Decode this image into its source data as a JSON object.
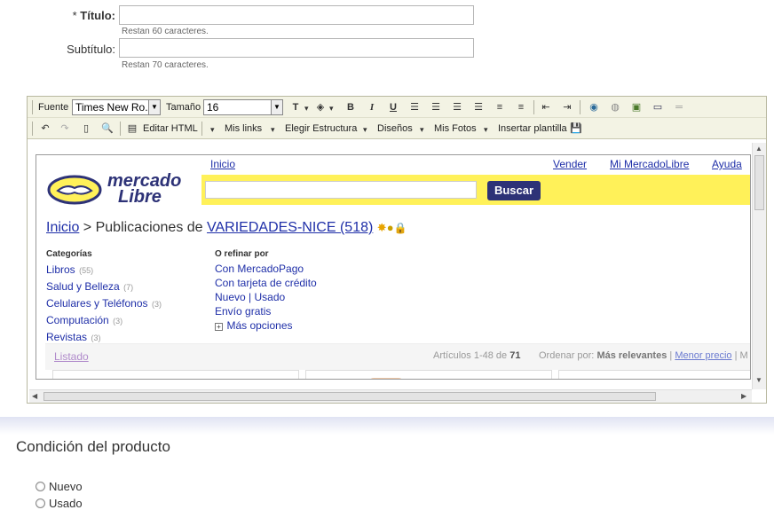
{
  "form": {
    "title_label": "Título:",
    "title_star": "*",
    "title_hint": "Restan 60 caracteres.",
    "subtitle_label": "Subtítulo:",
    "subtitle_hint": "Restan 70 caracteres."
  },
  "toolbar1": {
    "font_label": "Fuente",
    "font_value": "Times New Ro...",
    "size_label": "Tamaño",
    "size_value": "16"
  },
  "toolbar2": {
    "edit_html": "Editar HTML",
    "my_links": "Mis links",
    "choose_structure": "Elegir Estructura",
    "designs": "Diseños",
    "my_photos": "Mis Fotos",
    "insert_template": "Insertar plantilla"
  },
  "preview": {
    "top_links": {
      "inicio": "Inicio",
      "vender": "Vender",
      "mi_ml": "Mi MercadoLibre",
      "ayuda": "Ayuda"
    },
    "logo_line1": "mercado",
    "logo_line2": "Libre",
    "search_button": "Buscar",
    "breadcrumb_home": "Inicio",
    "breadcrumb_middle": " > Publicaciones de ",
    "breadcrumb_seller": "VARIEDADES-NICE (518)",
    "categories_title": "Categorías",
    "categories": [
      {
        "name": "Libros",
        "count": "(55)"
      },
      {
        "name": "Salud y Belleza",
        "count": "(7)"
      },
      {
        "name": "Celulares y Teléfonos",
        "count": "(3)"
      },
      {
        "name": "Computación",
        "count": "(3)"
      },
      {
        "name": "Revistas",
        "count": "(3)"
      }
    ],
    "refine_title": "O refinar por",
    "refine": [
      "Con MercadoPago",
      "Con tarjeta de crédito",
      "Nuevo | Usado",
      "Envío gratis",
      "Más opciones"
    ],
    "listado": "Listado",
    "articles_prefix": "Artículos 1-48 de",
    "articles_total": "71",
    "order_label": "Ordenar por:",
    "order_relevant": "Más relevantes",
    "order_sep": "|",
    "order_low": "Menor precio",
    "order_more": "| M"
  },
  "condition": {
    "heading": "Condición del producto",
    "options": [
      "Nuevo",
      "Usado"
    ]
  },
  "colors": {
    "ml_yellow": "#fff159",
    "ml_blue": "#2d3277",
    "link_blue": "#1f2fa8",
    "editor_toolbar": "#f3f3e4"
  }
}
